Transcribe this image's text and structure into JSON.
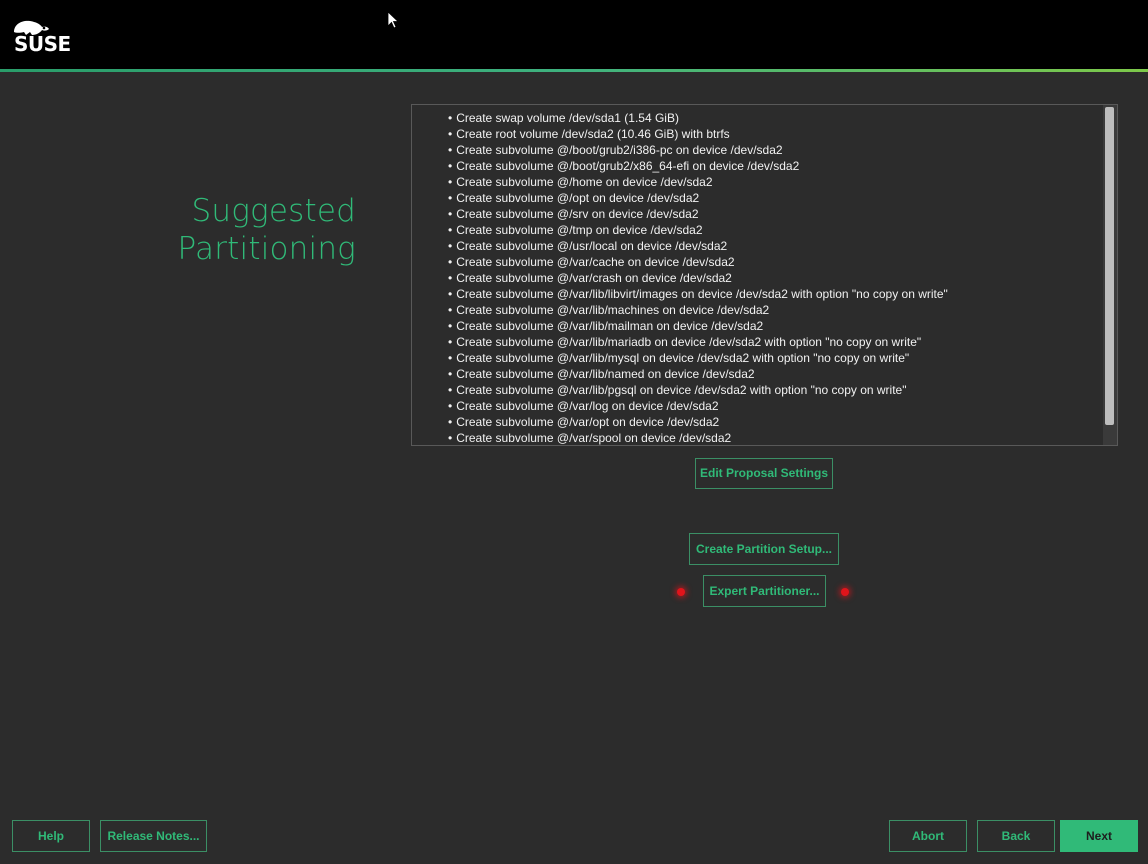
{
  "header": {
    "logo_alt": "SUSE",
    "logo_text": "SUSE"
  },
  "page": {
    "title_line1": "Suggested",
    "title_line2": "Partitioning"
  },
  "proposal": {
    "items": [
      "Create swap volume /dev/sda1 (1.54 GiB)",
      "Create root volume /dev/sda2 (10.46 GiB) with btrfs",
      "Create subvolume @/boot/grub2/i386-pc on device /dev/sda2",
      "Create subvolume @/boot/grub2/x86_64-efi on device /dev/sda2",
      "Create subvolume @/home on device /dev/sda2",
      "Create subvolume @/opt on device /dev/sda2",
      "Create subvolume @/srv on device /dev/sda2",
      "Create subvolume @/tmp on device /dev/sda2",
      "Create subvolume @/usr/local on device /dev/sda2",
      "Create subvolume @/var/cache on device /dev/sda2",
      "Create subvolume @/var/crash on device /dev/sda2",
      "Create subvolume @/var/lib/libvirt/images on device /dev/sda2 with option \"no copy on write\"",
      "Create subvolume @/var/lib/machines on device /dev/sda2",
      "Create subvolume @/var/lib/mailman on device /dev/sda2",
      "Create subvolume @/var/lib/mariadb on device /dev/sda2 with option \"no copy on write\"",
      "Create subvolume @/var/lib/mysql on device /dev/sda2 with option \"no copy on write\"",
      "Create subvolume @/var/lib/named on device /dev/sda2",
      "Create subvolume @/var/lib/pgsql on device /dev/sda2 with option \"no copy on write\"",
      "Create subvolume @/var/log on device /dev/sda2",
      "Create subvolume @/var/opt on device /dev/sda2",
      "Create subvolume @/var/spool on device /dev/sda2"
    ]
  },
  "actions": {
    "edit_proposal": "Edit Proposal Settings",
    "create_partition_setup": "Create Partition Setup...",
    "expert_partitioner": "Expert Partitioner..."
  },
  "footer": {
    "help": "Help",
    "release_notes": "Release Notes...",
    "abort": "Abort",
    "back": "Back",
    "next": "Next"
  },
  "colors": {
    "accent": "#30ba78",
    "background": "#2c2c2c",
    "header": "#000000",
    "alert_dot": "#e1141b"
  }
}
